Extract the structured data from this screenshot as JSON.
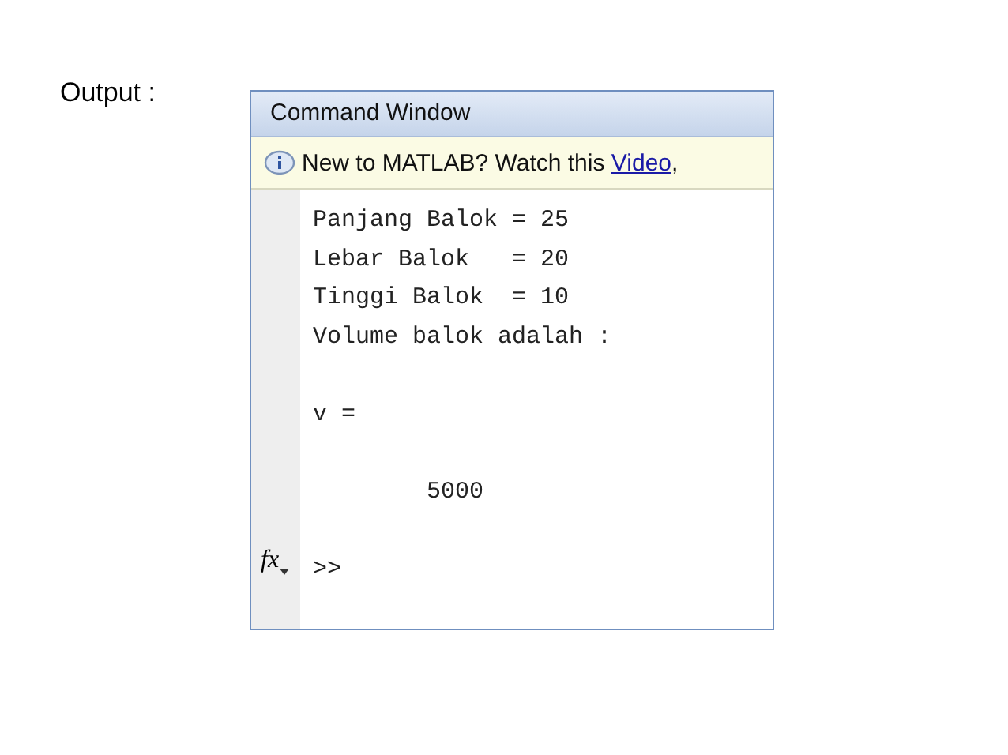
{
  "slide_label": "Output :",
  "window": {
    "title": "Command Window"
  },
  "info_bar": {
    "message": "New to MATLAB? Watch this",
    "link": "Video",
    "after_link": ","
  },
  "output_blocks": [
    [
      "Panjang Balok = 25",
      "Lebar Balok   = 20",
      "Tinggi Balok  = 10",
      "Volume balok adalah :"
    ],
    [
      "v ="
    ],
    [
      "        5000"
    ]
  ],
  "prompt": {
    "function_button": "fx",
    "text": ">>"
  }
}
